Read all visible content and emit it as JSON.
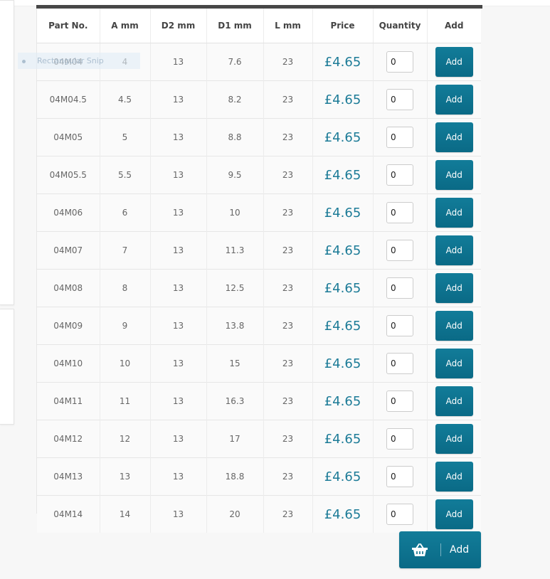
{
  "table": {
    "headers": [
      "Part No.",
      "A mm",
      "D2 mm",
      "D1 mm",
      "L mm",
      "Price",
      "Quantity",
      "Add"
    ],
    "rows": [
      {
        "part": "04M04",
        "a": "4",
        "d2": "13",
        "d1": "7.6",
        "l": "23",
        "price": "£4.65",
        "qty": "0",
        "add": "Add"
      },
      {
        "part": "04M04.5",
        "a": "4.5",
        "d2": "13",
        "d1": "8.2",
        "l": "23",
        "price": "£4.65",
        "qty": "0",
        "add": "Add"
      },
      {
        "part": "04M05",
        "a": "5",
        "d2": "13",
        "d1": "8.8",
        "l": "23",
        "price": "£4.65",
        "qty": "0",
        "add": "Add"
      },
      {
        "part": "04M05.5",
        "a": "5.5",
        "d2": "13",
        "d1": "9.5",
        "l": "23",
        "price": "£4.65",
        "qty": "0",
        "add": "Add"
      },
      {
        "part": "04M06",
        "a": "6",
        "d2": "13",
        "d1": "10",
        "l": "23",
        "price": "£4.65",
        "qty": "0",
        "add": "Add"
      },
      {
        "part": "04M07",
        "a": "7",
        "d2": "13",
        "d1": "11.3",
        "l": "23",
        "price": "£4.65",
        "qty": "0",
        "add": "Add"
      },
      {
        "part": "04M08",
        "a": "8",
        "d2": "13",
        "d1": "12.5",
        "l": "23",
        "price": "£4.65",
        "qty": "0",
        "add": "Add"
      },
      {
        "part": "04M09",
        "a": "9",
        "d2": "13",
        "d1": "13.8",
        "l": "23",
        "price": "£4.65",
        "qty": "0",
        "add": "Add"
      },
      {
        "part": "04M10",
        "a": "10",
        "d2": "13",
        "d1": "15",
        "l": "23",
        "price": "£4.65",
        "qty": "0",
        "add": "Add"
      },
      {
        "part": "04M11",
        "a": "11",
        "d2": "13",
        "d1": "16.3",
        "l": "23",
        "price": "£4.65",
        "qty": "0",
        "add": "Add"
      },
      {
        "part": "04M12",
        "a": "12",
        "d2": "13",
        "d1": "17",
        "l": "23",
        "price": "£4.65",
        "qty": "0",
        "add": "Add"
      },
      {
        "part": "04M13",
        "a": "13",
        "d2": "13",
        "d1": "18.8",
        "l": "23",
        "price": "£4.65",
        "qty": "0",
        "add": "Add"
      },
      {
        "part": "04M14",
        "a": "14",
        "d2": "13",
        "d1": "20",
        "l": "23",
        "price": "£4.65",
        "qty": "0",
        "add": "Add"
      }
    ]
  },
  "overlay": {
    "snip_label": "Rectangular Snip"
  },
  "basket_button": {
    "label": "Add",
    "icon": "basket-icon"
  },
  "colors": {
    "accent": "#0f7592",
    "price": "#1c7b97",
    "header_bar": "#474747"
  }
}
